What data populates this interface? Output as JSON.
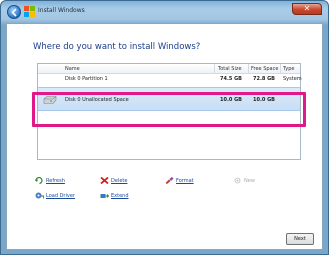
{
  "window": {
    "title": "Install Windows",
    "close_glyph": "✕",
    "back_icon": "back-arrow-icon",
    "app_icon": "windows-logo-icon"
  },
  "main": {
    "heading": "Where do you want to install Windows?"
  },
  "table": {
    "columns": [
      "Name",
      "Total Size",
      "Free Space",
      "Type"
    ],
    "rows": [
      {
        "name": "Disk 0 Partition 1",
        "total": "74.5 GB",
        "free": "72.8 GB",
        "type": "System"
      },
      {
        "name": "Disk 0 Unallocated Space",
        "total": "10.0 GB",
        "free": "10.0 GB",
        "type": ""
      }
    ]
  },
  "actions": {
    "refresh": "Refresh",
    "delete": "Delete",
    "format": "Format",
    "new": "New",
    "load_driver": "Load Driver",
    "extend": "Extend"
  },
  "footer": {
    "next_label": "Next"
  },
  "colors": {
    "highlight": "#e0188a",
    "link": "#1a4a99",
    "heading": "#1a3e8c"
  }
}
